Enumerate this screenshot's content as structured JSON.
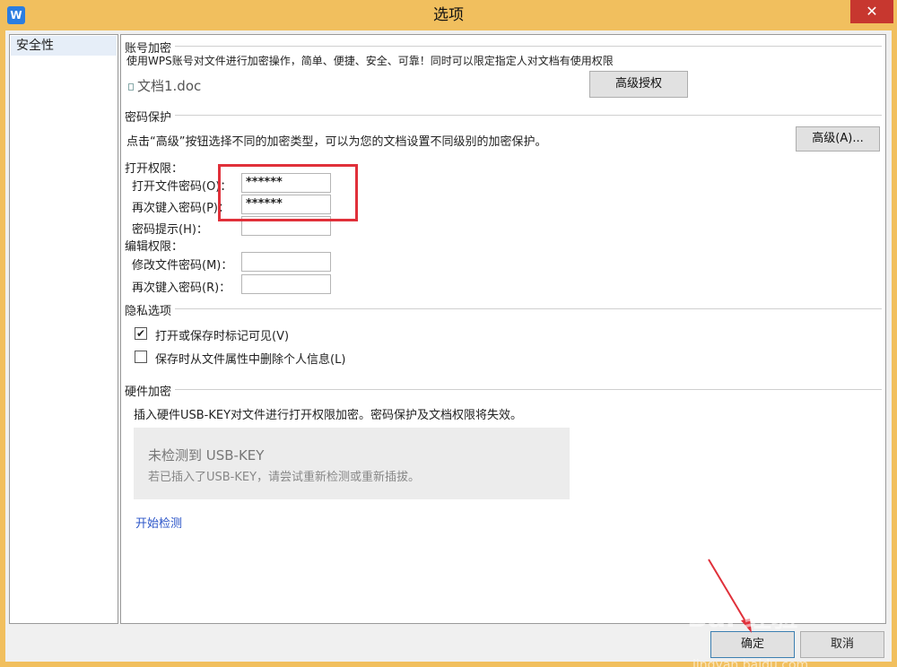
{
  "window": {
    "title": "选项",
    "app_icon_text": "W",
    "close_glyph": "✕"
  },
  "sidebar": {
    "items": [
      {
        "label": "安全性",
        "selected": true
      }
    ]
  },
  "account_encryption": {
    "title": "账号加密",
    "description": "使用WPS账号对文件进行加密操作，简单、便捷、安全、可靠！同时可以限定指定人对文档有使用权限",
    "doc_name": "文档1.doc",
    "advanced_auth_button": "高级授权"
  },
  "password_protection": {
    "title": "密码保护",
    "description": "点击“高级”按钮选择不同的加密类型，可以为您的文档设置不同级别的加密保护。",
    "advanced_button": "高级(A)..."
  },
  "open_permission": {
    "title": "打开权限：",
    "open_password_label": "打开文件密码(O)：",
    "open_password_value": "******",
    "confirm_password_label": "再次键入密码(P)：",
    "confirm_password_value": "******",
    "hint_label": "密码提示(H)：",
    "hint_value": ""
  },
  "edit_permission": {
    "title": "编辑权限：",
    "modify_password_label": "修改文件密码(M)：",
    "modify_password_value": "",
    "confirm_password_label": "再次键入密码(R)：",
    "confirm_password_value": ""
  },
  "privacy": {
    "title": "隐私选项",
    "options": [
      {
        "label": "打开或保存时标记可见(V)",
        "checked": true,
        "mark": "✔"
      },
      {
        "label": "保存时从文件属性中删除个人信息(L)",
        "checked": false,
        "mark": ""
      }
    ]
  },
  "hardware": {
    "title": "硬件加密",
    "description": "插入硬件USB-KEY对文件进行打开权限加密。密码保护及文档权限将失效。",
    "usb_status": "未检测到 USB-KEY",
    "usb_hint": "若已插入了USB-KEY，请尝试重新检测或重新插拔。",
    "detect_link": "开始检测"
  },
  "footer": {
    "ok_button": "确定",
    "cancel_button": "取消"
  },
  "watermark": {
    "text": "Bai 经验",
    "sub": "jingyan.baidu.com"
  },
  "colors": {
    "titlebar": "#f1bf5e",
    "close": "#c7372f",
    "highlight_box": "#e0303a",
    "link": "#2b55c8"
  }
}
